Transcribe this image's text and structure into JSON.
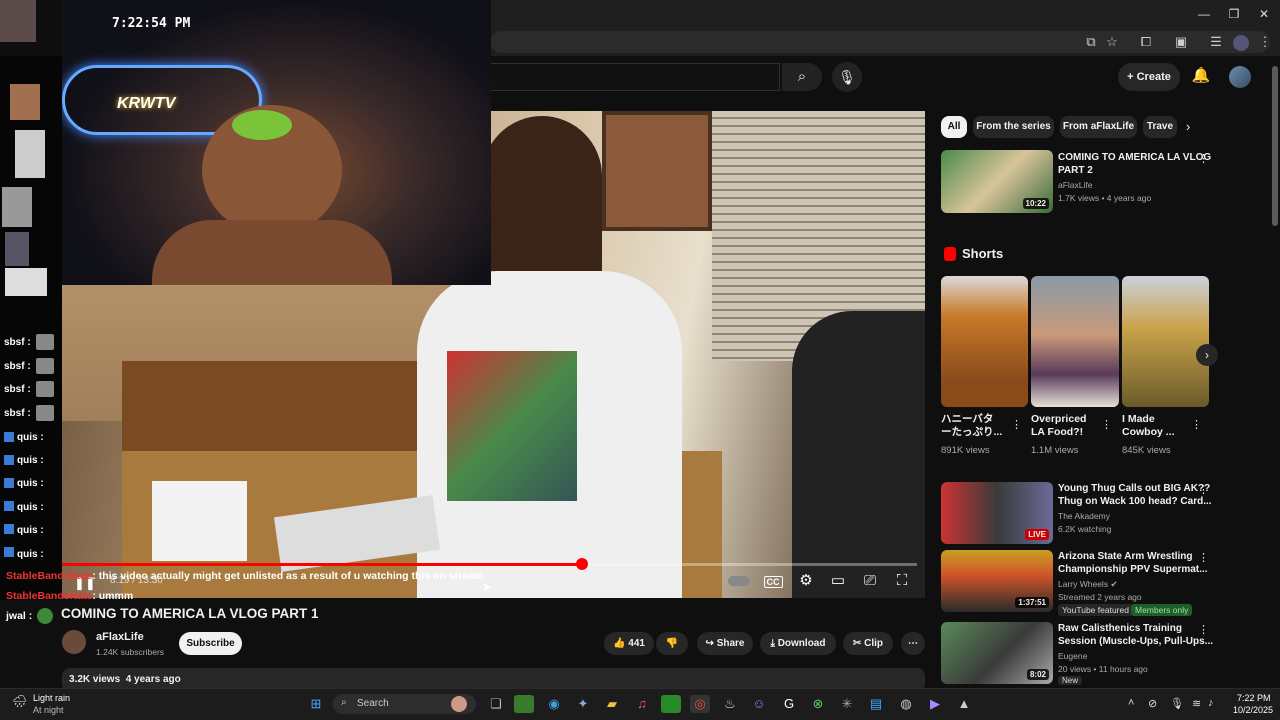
{
  "stream_clock": "7:22:54 PM",
  "webcam_sign": "KRWTV",
  "chat": [
    {
      "name": "sbsf :"
    },
    {
      "name": "sbsf :"
    },
    {
      "name": "sbsf :"
    },
    {
      "name": "sbsf :"
    },
    {
      "name": "quis :"
    },
    {
      "name": "quis :"
    },
    {
      "name": "quis :"
    },
    {
      "name": "quis :"
    },
    {
      "name": "quis :"
    },
    {
      "name": "quis :"
    }
  ],
  "chat_overlay": [
    {
      "user": "StableBandsNate",
      "message": ": this video actually might get unlisted as a result of u watching this on stream"
    },
    {
      "user": "StableBandsNate",
      "message": ": ummm"
    },
    {
      "user": "jwal :",
      "message": ""
    }
  ],
  "player": {
    "time": "8:19 / 13:30",
    "progress": 0.6085
  },
  "video": {
    "title": "COMING TO AMERICA LA VLOG PART 1",
    "channel": "aFlaxLife",
    "subscribers": "1.24K subscribers",
    "subscribe_label": "Subscribe",
    "likes": "441",
    "share_label": "Share",
    "download_label": "Download",
    "clip_label": "Clip",
    "views": "3.2K views",
    "age": "4 years ago"
  },
  "header": {
    "create_label": "Create"
  },
  "chips": [
    "All",
    "From the series",
    "From aFlaxLife",
    "Trave"
  ],
  "related_top": {
    "title_line1": "COMING TO AMERICA LA VLOG",
    "title_line2": "PART 2",
    "channel": "aFlaxLife",
    "meta": "1.7K views • 4 years ago",
    "duration": "10:22"
  },
  "shorts": {
    "heading": "Shorts",
    "items": [
      {
        "title1": "ハニーバタ",
        "title2": "ーたっぷり...",
        "views": "891K views"
      },
      {
        "title1": "Overpriced",
        "title2": "LA Food?!",
        "views": "1.1M views"
      },
      {
        "title1": "I Made",
        "title2": "Cowboy ...",
        "views": "845K views"
      }
    ]
  },
  "related": [
    {
      "title1": "Young Thug Calls out BIG AK??",
      "title2": "Thug on Wack 100 head? Card...",
      "channel": "The Akademy",
      "meta": "6.2K watching",
      "badge": "LIVE"
    },
    {
      "title1": "Arizona State Arm Wrestling",
      "title2": "Championship PPV Supermat...",
      "channel": "Larry Wheels",
      "meta": "Streamed 2 years ago",
      "duration": "1:37:51",
      "tag1": "YouTube featured",
      "tag2": "Members only"
    },
    {
      "title1": "Raw Calisthenics Training",
      "title2": "Session (Muscle-Ups, Pull-Ups...",
      "channel": "Eugene",
      "meta": "20 views • 11 hours ago",
      "duration": "8:02",
      "tag1": "New"
    }
  ],
  "taskbar": {
    "weather_title": "Light rain",
    "weather_sub": "At night",
    "search_placeholder": "Search",
    "time": "7:22 PM",
    "date": "10/2/2025"
  },
  "colors": {
    "accent_red": "#ff0000",
    "bg": "#0f0f0f",
    "chip_bg": "#272727"
  }
}
